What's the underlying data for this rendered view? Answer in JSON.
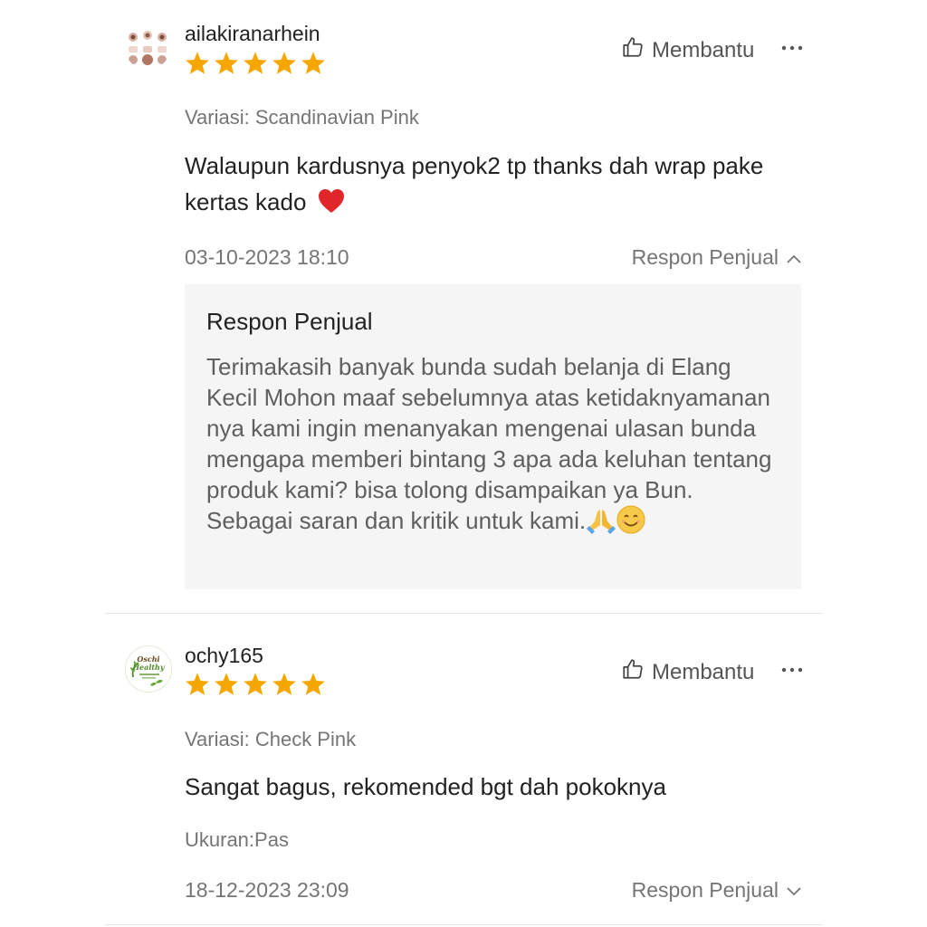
{
  "reviews": [
    {
      "username": "ailakiranarhein",
      "rating": 5,
      "helpful_label": "Membantu",
      "more_icon": "more-horizontal-icon",
      "variation": "Variasi: Scandinavian Pink",
      "comment": "Walaupun kardusnya penyok2 tp thanks dah wrap pake kertas kado",
      "comment_emoji": "red-heart",
      "timestamp": "03-10-2023 18:10",
      "seller_response_toggle": "Respon Penjual",
      "seller_response_expanded": true,
      "seller_response": {
        "title": "Respon Penjual",
        "text": "Terimakasih banyak bunda sudah belanja di Elang Kecil Mohon maaf sebelumnya atas ketidaknyamanan nya kami ingin menanyakan mengenai ulasan bunda mengapa memberi bintang 3 apa ada keluhan tentang produk kami? bisa tolong disampaikan ya Bun. Sebagai saran dan kritik untuk kami.",
        "emojis": [
          "folded-hands",
          "smiling-face"
        ]
      }
    },
    {
      "username": "ochy165",
      "rating": 5,
      "helpful_label": "Membantu",
      "more_icon": "more-horizontal-icon",
      "variation": "Variasi: Check Pink",
      "comment": "Sangat bagus, rekomended bgt dah pokoknya",
      "size_note": "Ukuran:Pas",
      "timestamp": "18-12-2023 23:09",
      "seller_response_toggle": "Respon Penjual",
      "seller_response_expanded": false,
      "avatar_text": [
        "Oschi",
        "Healthy"
      ]
    }
  ],
  "colors": {
    "star": "#f6a600",
    "text_primary": "#222222",
    "text_secondary": "#757575",
    "response_bg": "#f5f5f5",
    "divider": "#e6e6e6"
  }
}
